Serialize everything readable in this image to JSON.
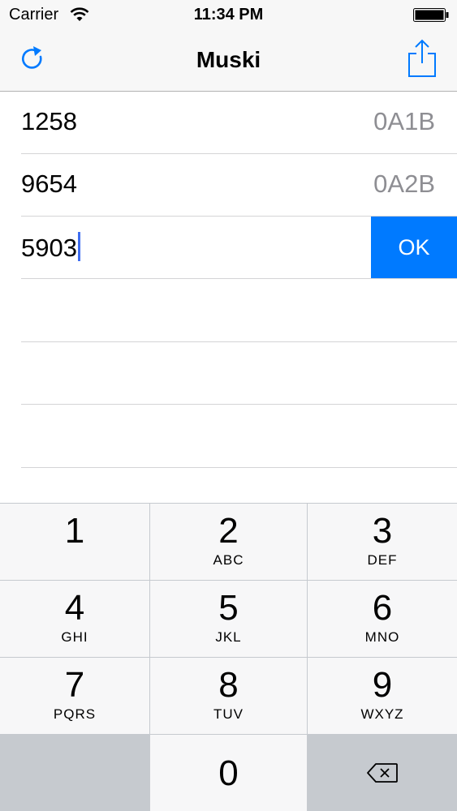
{
  "status": {
    "carrier": "Carrier",
    "time": "11:34 PM"
  },
  "nav": {
    "title": "Muski"
  },
  "rows": [
    {
      "guess": "1258",
      "result": "0A1B"
    },
    {
      "guess": "9654",
      "result": "0A2B"
    }
  ],
  "input": {
    "value": "5903",
    "ok_label": "OK"
  },
  "keypad": {
    "keys": [
      {
        "num": "1",
        "letters": ""
      },
      {
        "num": "2",
        "letters": "ABC"
      },
      {
        "num": "3",
        "letters": "DEF"
      },
      {
        "num": "4",
        "letters": "GHI"
      },
      {
        "num": "5",
        "letters": "JKL"
      },
      {
        "num": "6",
        "letters": "MNO"
      },
      {
        "num": "7",
        "letters": "PQRS"
      },
      {
        "num": "8",
        "letters": "TUV"
      },
      {
        "num": "9",
        "letters": "WXYZ"
      },
      {
        "num": "0",
        "letters": ""
      }
    ]
  },
  "colors": {
    "accent": "#007aff",
    "caret": "#3f6ef0",
    "muted": "#8e8e93"
  }
}
